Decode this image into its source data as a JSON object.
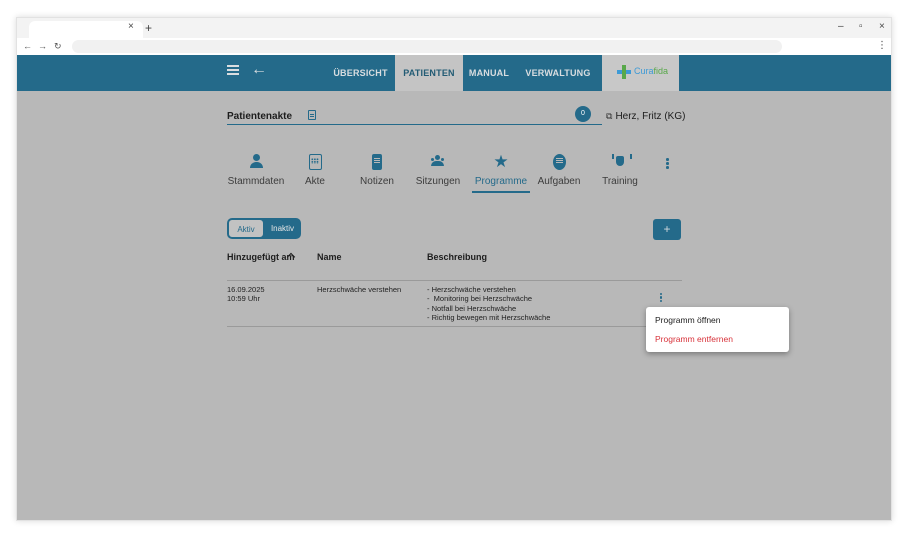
{
  "browser": {
    "tab_close": "×",
    "tab_new": "+",
    "min": "–",
    "restore": "▫",
    "close": "×",
    "nav_back": "←",
    "nav_forward": "→",
    "nav_reload": "↻",
    "menu": "⋮"
  },
  "appbar": {
    "menu_items": [
      "ÜBERSICHT",
      "PATIENTEN",
      "MANUAL",
      "VERWALTUNG"
    ],
    "active_item": "PATIENTEN",
    "logo_text_a": "Cura",
    "logo_text_b": "fida",
    "colors": {
      "primary": "#246a8a",
      "logo_blue": "#3d9ad6",
      "logo_green": "#58a84a"
    }
  },
  "header": {
    "title": "Patientenakte",
    "badge_count": "0",
    "patient_name": "Herz, Fritz (KG)",
    "patient_link_icon": "external-link-icon"
  },
  "tabs": [
    {
      "label": "Stammdaten",
      "icon": "person-icon"
    },
    {
      "label": "Akte",
      "icon": "calendar-icon"
    },
    {
      "label": "Notizen",
      "icon": "note-icon"
    },
    {
      "label": "Sitzungen",
      "icon": "group-icon"
    },
    {
      "label": "Programme",
      "icon": "star-icon",
      "active": true
    },
    {
      "label": "Aufgaben",
      "icon": "list-icon"
    },
    {
      "label": "Training",
      "icon": "training-icon"
    }
  ],
  "filter": {
    "active_label": "Aktiv",
    "inactive_label": "Inaktiv",
    "selected": "Aktiv"
  },
  "add_button_label": "+",
  "table": {
    "columns": [
      "Hinzugefügt am",
      "Name",
      "Beschreibung"
    ],
    "rows": [
      {
        "date": "16.09.2025",
        "time": "10:59 Uhr",
        "name": "Herzschwäche verstehen",
        "description": "- Herzschwäche verstehen\n-  Monitoring bei Herzschwäche\n- Notfall bei Herzschwäche\n- Richtig bewegen mit Herzschwäche"
      }
    ]
  },
  "context_menu": {
    "open_label": "Programm öffnen",
    "remove_label": "Programm entfernen",
    "remove_color": "#d8323a"
  }
}
